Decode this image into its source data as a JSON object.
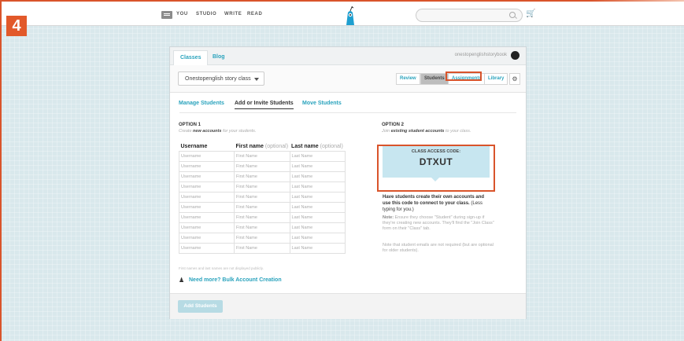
{
  "step_number": "4",
  "nav": {
    "links": [
      "YOU",
      "STUDIO",
      "WRITE",
      "READ"
    ]
  },
  "card": {
    "tabs": [
      "Classes",
      "Blog"
    ],
    "account": "onestopenglishstorybook",
    "class_select": "Onestopenglish story class",
    "segments": [
      "Review",
      "Students",
      "Assignments",
      "Library"
    ],
    "subtabs": [
      "Manage Students",
      "Add or Invite Students",
      "Move Students"
    ],
    "option1": {
      "title": "OPTION 1",
      "sub_pre": "Create ",
      "sub_bold": "new accounts",
      "sub_post": " for your students."
    },
    "option2": {
      "title": "OPTION 2",
      "sub_pre": "Join ",
      "sub_bold": "existing student accounts",
      "sub_post": " to your class."
    },
    "table": {
      "headers": [
        "Username",
        "First name",
        "Last name"
      ],
      "optional": "(optional)",
      "placeholders": [
        "Username",
        "First Name",
        "Last Name"
      ],
      "row_count": 10
    },
    "fineprint": "First names and last names are not displayed publicly.",
    "more_link": "Need more? Bulk Account Creation",
    "add_button": "Add Students",
    "code_label": "CLASS ACCESS CODE:",
    "code_value": "DTXUT",
    "instructions_bold": "Have students create their own accounts and use this code to connect to your class.",
    "instructions_light": "(Less typing for you.)",
    "note1_label": "Note:",
    "note1": "Ensure they choose \"Student\" during sign-up if they're creating new accounts. They'll find the \"Join Class\" form on their \"Class\" tab.",
    "note2": "Note that student emails are not required (but are optional for older students)."
  },
  "colors": {
    "accent": "#2aa3bd",
    "highlight": "#d9542b",
    "code_bg": "#c7e6f0"
  }
}
